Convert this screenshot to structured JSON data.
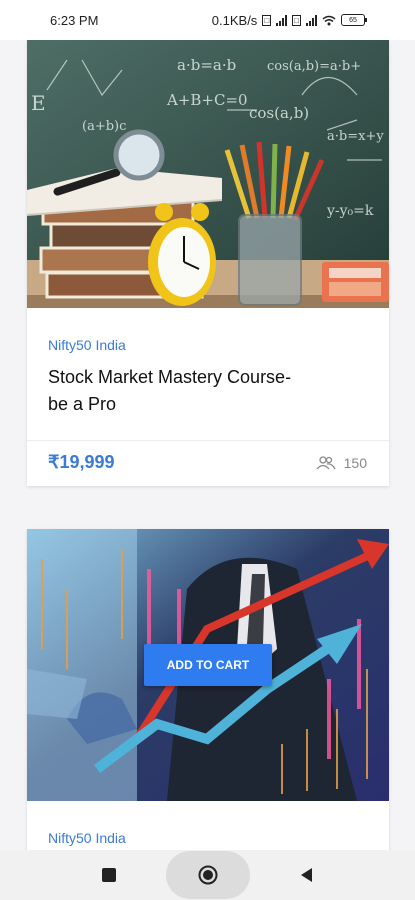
{
  "status_bar": {
    "time": "6:23 PM",
    "speed": "0.1KB/s",
    "battery": "65"
  },
  "courses": [
    {
      "category": "Nifty50 India",
      "title": "Stock Market Mastery Course- be a Pro",
      "price": "₹19,999",
      "students": "150"
    },
    {
      "category": "Nifty50 India",
      "action_label": "ADD TO CART"
    }
  ],
  "images": {
    "chalkboard_text": [
      "a·b=a·b",
      "cos(a,b)=a·b+",
      "A+B+C=0",
      "cos(a,b)",
      "a·b=x+y",
      "y-y₀=k",
      "(a+b)c",
      "E"
    ]
  },
  "colors": {
    "accent": "#3a7bd5",
    "button": "#2f7cf0",
    "chalkboard": "#2f4f48"
  },
  "icons": {
    "students": "users-icon",
    "nav_recent": "square-icon",
    "nav_home": "circle-icon",
    "nav_back": "triangle-back-icon"
  }
}
